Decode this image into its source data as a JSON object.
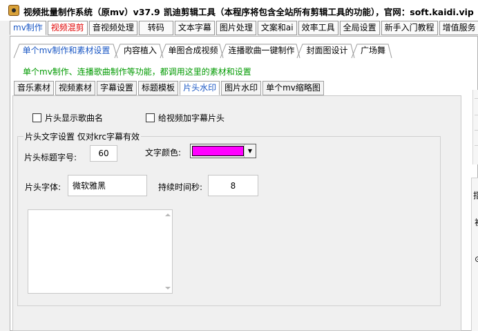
{
  "window": {
    "title": "视频批量制作系统（原mv）v37.9",
    "extra": "凯迪剪辑工具（本程序将包含全站所有剪辑工具的功能），官网：soft.kaidi.vip"
  },
  "menu_tabs": [
    "mv制作",
    "视频混剪",
    "音视频处理",
    "转码",
    "文本字幕",
    "图片处理",
    "文案和ai",
    "效率工具",
    "全局设置",
    "新手入门教程",
    "增值服务"
  ],
  "sub_tabs": [
    "单个mv制作和素材设置",
    "内容植入",
    "单图合成视频",
    "连播歌曲一键制作",
    "封面图设计",
    "广场舞"
  ],
  "hint": "单个mv制作、连播歌曲制作等功能，都调用这里的素材和设置",
  "inner_tabs": [
    "音乐素材",
    "视频素材",
    "字幕设置",
    "标题模板",
    "片头水印",
    "图片水印",
    "单个mv缩略图"
  ],
  "opening": {
    "show_song_name": "片头显示歌曲名",
    "add_subtitle_opening": "给视频加字幕片头",
    "group_title": "片头文字设置 仅对krc字幕有效",
    "title_font_size_label": "片头标题字号:",
    "title_font_size": "60",
    "text_color_label": "文字颜色:",
    "text_color": "#ff00ff",
    "font_label": "片头字体:",
    "font": "微软雅黑",
    "duration_label": "持续时间秒:",
    "duration": "8"
  },
  "edge_glyphs": [
    "指",
    "初",
    "⊙"
  ],
  "colors": {
    "active_tab": "#1a57c4",
    "red_tab": "#e00000",
    "hint": "#009a00"
  }
}
